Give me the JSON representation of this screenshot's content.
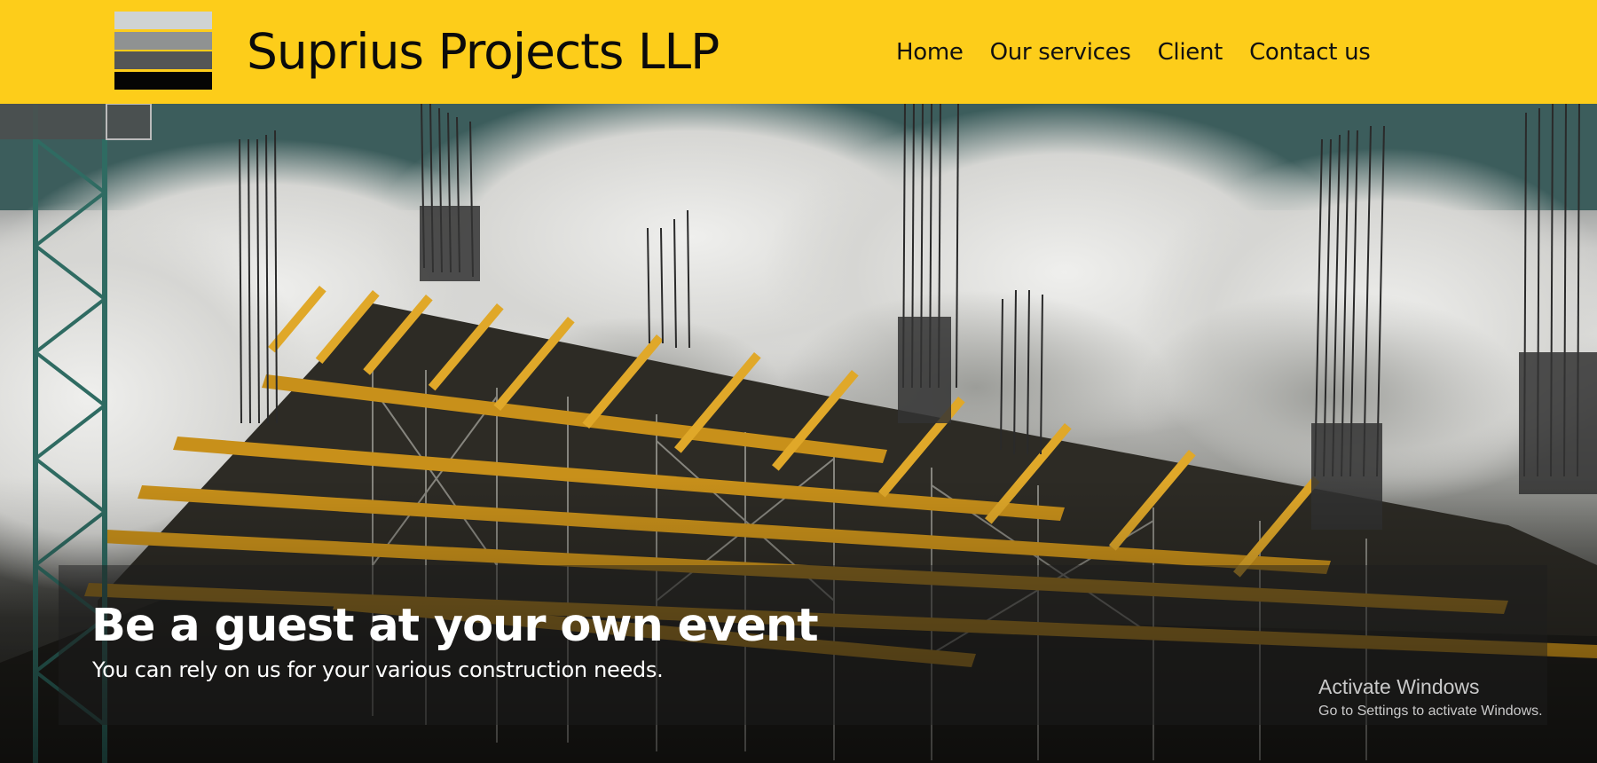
{
  "brand": {
    "name": "Suprius Projects LLP"
  },
  "nav": {
    "items": [
      {
        "label": "Home"
      },
      {
        "label": "Our services"
      },
      {
        "label": "Client"
      },
      {
        "label": "Contact us"
      }
    ]
  },
  "hero": {
    "title": "Be a guest at your own event",
    "subtitle": "You can rely on us for your various construction needs."
  },
  "watermark": {
    "title": "Activate Windows",
    "subtitle": "Go to Settings to activate Windows."
  },
  "colors": {
    "header_bg": "#fdcd1a",
    "logo_bars": [
      "#cfd3d3",
      "#8f9292",
      "#535656",
      "#050505"
    ],
    "sky": "#3b5c5c",
    "beam": "#c8901a"
  },
  "icons": {
    "logo": "stacked-bars-logo"
  }
}
